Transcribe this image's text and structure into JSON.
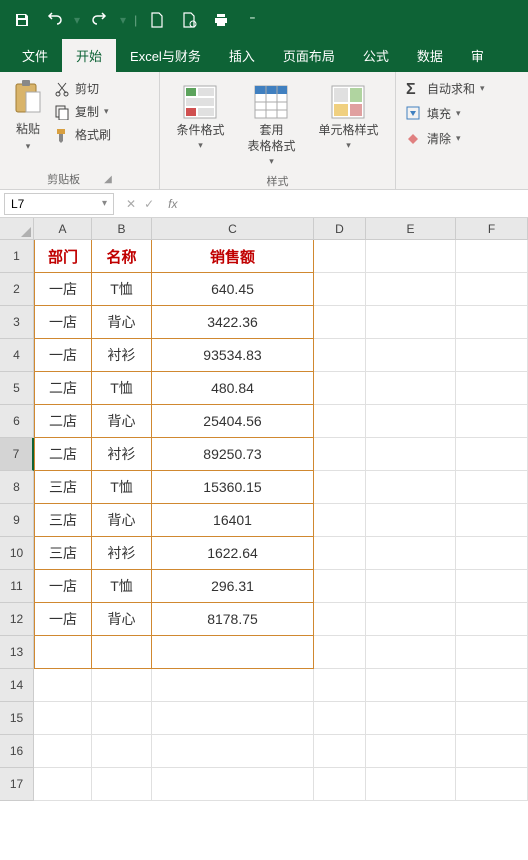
{
  "qat": {
    "save": "save",
    "undo": "undo",
    "redo": "redo"
  },
  "menu": {
    "file": "文件",
    "home": "开始",
    "finance": "Excel与财务",
    "insert": "插入",
    "layout": "页面布局",
    "formula": "公式",
    "data": "数据",
    "review": "审"
  },
  "ribbon": {
    "clipboard": {
      "paste": "粘贴",
      "cut": "剪切",
      "copy": "复制",
      "format_painter": "格式刷",
      "group_label": "剪贴板"
    },
    "styles": {
      "cond_format": "条件格式",
      "table_format": "套用\n表格格式",
      "cell_style": "单元格样式",
      "group_label": "样式"
    },
    "editing": {
      "autosum": "自动求和",
      "fill": "填充",
      "clear": "清除"
    }
  },
  "formula_bar": {
    "name_box": "L7",
    "fx": "fx"
  },
  "chart_data": {
    "type": "table",
    "columns": [
      "A",
      "B",
      "C",
      "D",
      "E",
      "F"
    ],
    "header_row": [
      "部门",
      "名称",
      "销售额"
    ],
    "rows": [
      [
        "一店",
        "T恤",
        "640.45"
      ],
      [
        "一店",
        "背心",
        "3422.36"
      ],
      [
        "一店",
        "衬衫",
        "93534.83"
      ],
      [
        "二店",
        "T恤",
        "480.84"
      ],
      [
        "二店",
        "背心",
        "25404.56"
      ],
      [
        "二店",
        "衬衫",
        "89250.73"
      ],
      [
        "三店",
        "T恤",
        "15360.15"
      ],
      [
        "三店",
        "背心",
        "16401"
      ],
      [
        "三店",
        "衬衫",
        "1622.64"
      ],
      [
        "一店",
        "T恤",
        "296.31"
      ],
      [
        "一店",
        "背心",
        "8178.75"
      ]
    ],
    "active_row": 7,
    "total_visible_rows": 17
  }
}
